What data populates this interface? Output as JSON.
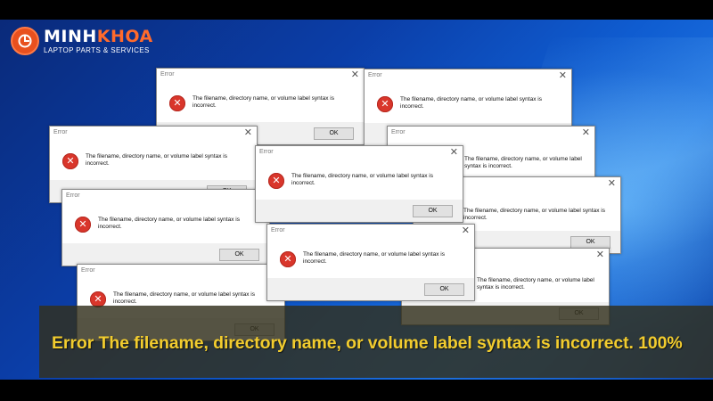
{
  "brand": {
    "name_part1": "MINH",
    "name_part2": "KHOA",
    "tagline": "LAPTOP PARTS & SERVICES",
    "color": "#e8501e"
  },
  "dialog_common": {
    "title": "Error",
    "close_glyph": "✕",
    "icon": "error-x-icon",
    "icon_color": "#d9362b"
  },
  "dialogs": [
    {
      "message": "The filename, directory name, or volume label syntax is incorrect.",
      "ok_label": "OK"
    },
    {
      "message": "The filename, directory name, or volume label syntax is incorrect.",
      "ok_label": "OK"
    },
    {
      "message": "The filename, directory name, or volume label syntax is incorrect.",
      "ok_label": "OK"
    },
    {
      "message": "The filename, directory name, or volume label syntax is incorrect.",
      "ok_label": "OK"
    },
    {
      "message": "The filename, directory name, or volume label syntax is incorrect.",
      "ok_label": "OK"
    },
    {
      "message": "The filename, directory name, or volume label syntax is incorrect.",
      "ok_label": "OK"
    },
    {
      "message": "The filename, directory name, or volume label syntax is incorrect.",
      "ok_label": "OK"
    },
    {
      "message": "The filename, directory name, or volume label syntax is incorrect.",
      "ok_label": "OK"
    },
    {
      "message": "The filename, directory name, or volume label syntax is incorrect.",
      "ok_label": "OK"
    },
    {
      "message": "The filename, directory name, or volume label syntax is incorrect.",
      "ok_label": "OK"
    }
  ],
  "banner": {
    "text": "Error The filename, directory name, or volume label syntax is incorrect. 100%",
    "color": "#f2cc2e"
  }
}
